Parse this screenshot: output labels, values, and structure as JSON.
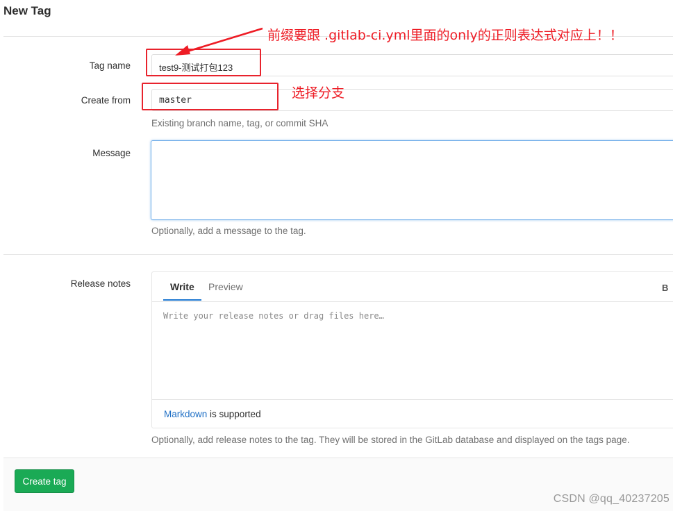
{
  "page": {
    "title": "New Tag"
  },
  "form": {
    "tag_name": {
      "label": "Tag name",
      "value": "test9-测试打包123"
    },
    "create_from": {
      "label": "Create from",
      "value": "master",
      "help": "Existing branch name, tag, or commit SHA"
    },
    "message": {
      "label": "Message",
      "help": "Optionally, add a message to the tag."
    },
    "release_notes": {
      "label": "Release notes",
      "tabs": [
        {
          "label": "Write",
          "active": true
        },
        {
          "label": "Preview",
          "active": false
        }
      ],
      "toolbar_bold": "B",
      "placeholder": "Write your release notes or drag files here…",
      "markdown_link": "Markdown",
      "markdown_suffix": " is supported",
      "help": "Optionally, add release notes to the tag. They will be stored in the GitLab database and displayed on the tags page."
    },
    "submit_label": "Create tag"
  },
  "annotations": {
    "tag_name_note": "前缀要跟 .gitlab-ci.yml里面的only的正则表达式对应上！！",
    "create_from_note": "选择分支"
  },
  "watermark": "CSDN @qq_40237205",
  "colors": {
    "primary_green": "#1aaa55",
    "link_blue": "#1f6fc5",
    "focus_border": "#73afea",
    "annotation_red": "#ee1c25"
  }
}
